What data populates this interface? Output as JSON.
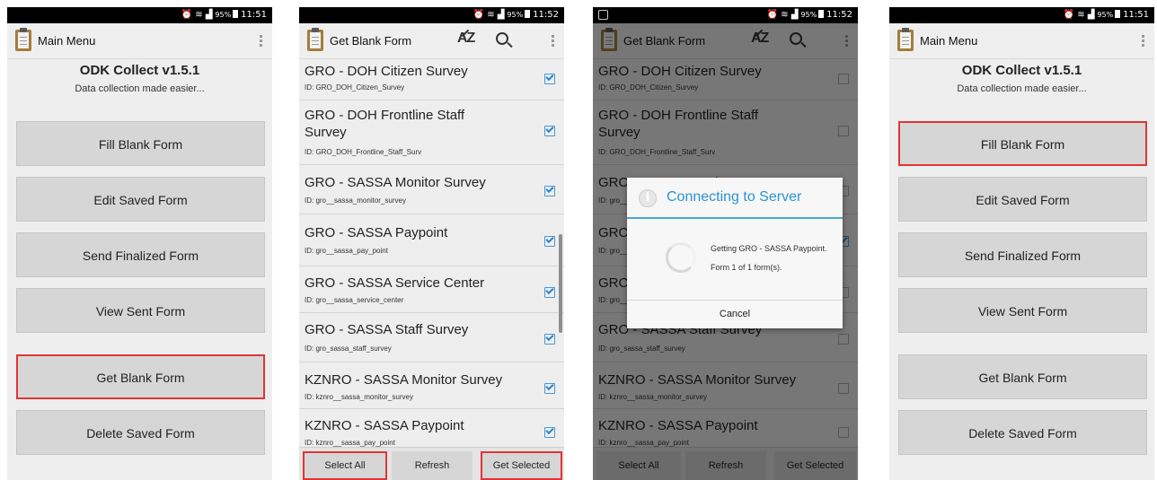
{
  "status": {
    "time_1": "11:51",
    "time_2": "11:52",
    "time_3": "11:52",
    "time_4": "11:51",
    "battery": "95%"
  },
  "main_menu": {
    "title": "Main Menu",
    "app_name": "ODK Collect v1.5.1",
    "tagline": "Data collection made easier...",
    "buttons": [
      "Fill Blank Form",
      "Edit Saved Form",
      "Send Finalized Form",
      "View Sent Form",
      "Get Blank Form",
      "Delete Saved Form"
    ]
  },
  "get_blank_form": {
    "title": "Get Blank Form",
    "sort_icon": "AZ",
    "forms": [
      {
        "title": "GRO - DOH Citizen Survey",
        "id": "ID: GRO_DOH_Citizen_Survey"
      },
      {
        "title": "GRO - DOH Frontline Staff Survey",
        "id": "ID: GRO_DOH_Frontline_Staff_Surv"
      },
      {
        "title": "GRO - SASSA Monitor Survey",
        "id": "ID: gro__sassa_monitor_survey"
      },
      {
        "title": "GRO - SASSA Paypoint",
        "id": "ID: gro__sassa_pay_point"
      },
      {
        "title": "GRO - SASSA Service Center",
        "id": "ID: gro__sassa_service_center"
      },
      {
        "title": "GRO - SASSA Staff Survey",
        "id": "ID: gro_sassa_staff_survey"
      },
      {
        "title": "KZNRO - SASSA Monitor Survey",
        "id": "ID: kznro__sassa_monitor_survey"
      },
      {
        "title": "KZNRO - SASSA Paypoint",
        "id": "ID: kznro__sassa_pay_point"
      }
    ],
    "buttons": {
      "select_all": "Select All",
      "refresh": "Refresh",
      "get_selected": "Get Selected"
    }
  },
  "dialog": {
    "title": "Connecting to Server",
    "line1": "Getting GRO - SASSA Paypoint.",
    "line2": "Form 1 of 1 form(s).",
    "cancel": "Cancel"
  },
  "colors": {
    "highlight": "#e23434",
    "accent": "#2a93d5"
  }
}
